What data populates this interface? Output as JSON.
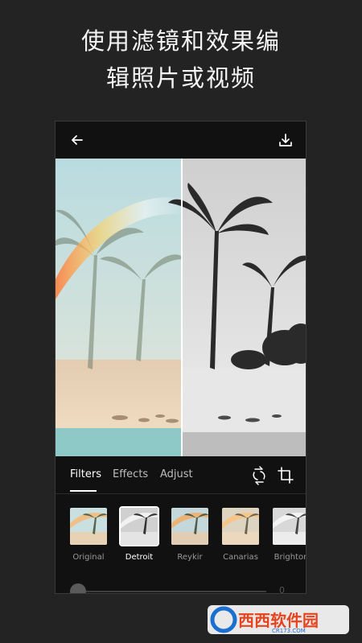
{
  "headline": {
    "line1": "使用滤镜和效果编",
    "line2": "辑照片或视频"
  },
  "toolbar": {
    "back_icon": "arrow-left-icon",
    "download_icon": "download-icon"
  },
  "tabs": [
    {
      "label": "Filters",
      "active": true
    },
    {
      "label": "Effects",
      "active": false
    },
    {
      "label": "Adjust",
      "active": false
    }
  ],
  "tools": {
    "swap_icon": "swap-icon",
    "crop_icon": "crop-icon"
  },
  "filters": [
    {
      "name": "Original",
      "selected": false,
      "tone": "color"
    },
    {
      "name": "Detroit",
      "selected": true,
      "tone": "bw"
    },
    {
      "name": "Reykir",
      "selected": false,
      "tone": "color"
    },
    {
      "name": "Canarias",
      "selected": false,
      "tone": "warm"
    },
    {
      "name": "Brighton",
      "selected": false,
      "tone": "bw"
    }
  ],
  "slider": {
    "value": "0",
    "level": 0
  },
  "watermark": {
    "logo": "C",
    "brand": "西西软件园",
    "url": "CR173.COM"
  },
  "colors": {
    "background": "#232323",
    "accent": "#ffffff",
    "watermark_red": "#e8431f",
    "watermark_blue": "#1a6fd0"
  }
}
